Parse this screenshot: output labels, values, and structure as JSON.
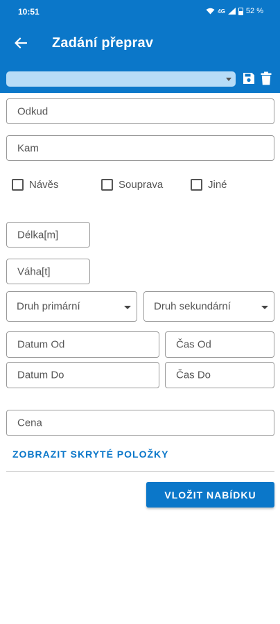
{
  "status_bar": {
    "time": "10:51",
    "battery": "52 %",
    "network": "4G"
  },
  "app_bar": {
    "title": "Zadání přeprav"
  },
  "sub_bar": {
    "selected_value": ""
  },
  "form": {
    "from_label": "Odkud",
    "to_label": "Kam",
    "checkboxes": [
      {
        "label": "Návěs",
        "checked": false
      },
      {
        "label": "Souprava",
        "checked": false
      },
      {
        "label": "Jiné",
        "checked": false
      }
    ],
    "length_label": "Délka[m]",
    "weight_label": "Váha[t]",
    "primary_type_label": "Druh primární",
    "secondary_type_label": "Druh sekundární",
    "date_from_label": "Datum Od",
    "time_from_label": "Čas Od",
    "date_to_label": "Datum Do",
    "time_to_label": "Čas Do",
    "price_label": "Cena",
    "show_hidden_link": "ZOBRAZIT SKRYTÉ POLOŽKY",
    "submit_label": "VLOŽIT NABÍDKU"
  },
  "colors": {
    "primary": "#0b77c9",
    "select_bg": "#b7dcf7",
    "border": "#9a9a9a"
  },
  "icons": {
    "back": "arrow-left-icon",
    "save": "floppy-disk-icon",
    "delete": "trash-icon"
  }
}
